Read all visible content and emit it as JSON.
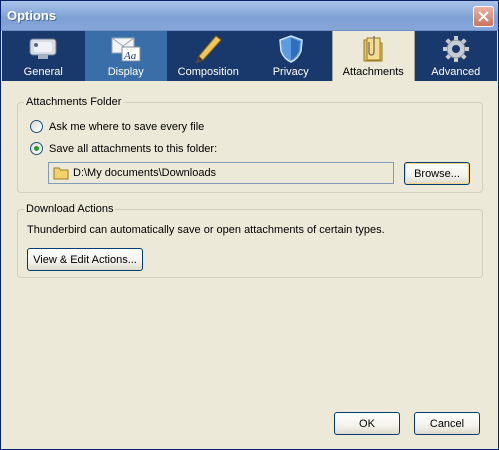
{
  "window": {
    "title": "Options"
  },
  "toolbar": {
    "tabs": [
      {
        "label": "General",
        "icon": "general-settings-icon"
      },
      {
        "label": "Display",
        "icon": "display-font-icon"
      },
      {
        "label": "Composition",
        "icon": "pencil-icon"
      },
      {
        "label": "Privacy",
        "icon": "shield-icon"
      },
      {
        "label": "Attachments",
        "icon": "paperclip-folder-icon"
      },
      {
        "label": "Advanced",
        "icon": "gear-icon"
      }
    ],
    "active_tab": "Attachments"
  },
  "attachments_folder": {
    "legend": "Attachments Folder",
    "option_ask": "Ask me where to save every file",
    "option_save": "Save all attachments to this folder:",
    "selected": "save",
    "folder_path": "D:\\My documents\\Downloads",
    "browse_label": "Browse..."
  },
  "download_actions": {
    "legend": "Download Actions",
    "description": "Thunderbird can automatically save or open attachments of certain types.",
    "view_edit_label": "View & Edit Actions..."
  },
  "footer": {
    "ok_label": "OK",
    "cancel_label": "Cancel"
  },
  "colors": {
    "title_bar": "#8eaedd",
    "toolbar": "#19386b",
    "display_tab": "#3a6ea8",
    "dialog_bg": "#ece9d8"
  }
}
